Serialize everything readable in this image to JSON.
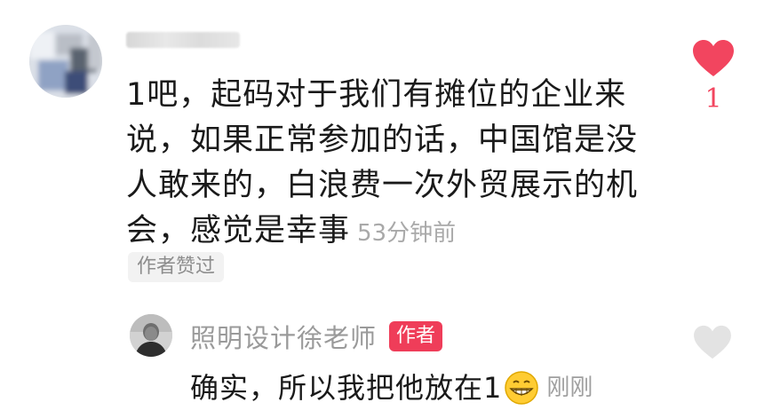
{
  "comment": {
    "text": "1吧，起码对于我们有摊位的企业来说，如果正常参加的话，中国馆是没人敢来的，白浪费一次外贸展示的机会，感觉是幸事",
    "time": "53分钟前",
    "author_liked_label": "作者赞过",
    "like_count": "1",
    "liked": true
  },
  "reply": {
    "username": "照明设计徐老师",
    "author_tag": "作者",
    "text": "确实，所以我把他放在1",
    "emoji": "grinning-face",
    "time": "刚刚",
    "liked": false
  },
  "colors": {
    "like_red": "#F2455F",
    "author_tag_bg": "#EF3D59",
    "muted_text": "#A9A9A9",
    "badge_bg": "#F2F2F2",
    "unliked_heart": "#E3E3E3"
  }
}
